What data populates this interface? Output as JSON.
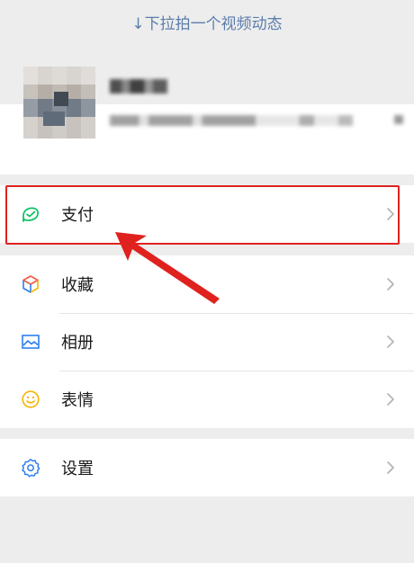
{
  "pull_hint": "↓下拉拍一个视频动态",
  "menu": {
    "pay": "支付",
    "favorites": "收藏",
    "album": "相册",
    "stickers": "表情",
    "settings": "设置"
  },
  "colors": {
    "accent_green": "#07c160",
    "hint_blue": "#5b7dac",
    "highlight_red": "#e0221f"
  },
  "icons": [
    "wallet-icon",
    "cube-icon",
    "image-icon",
    "smile-icon",
    "gear-icon",
    "chevron-right-icon"
  ]
}
